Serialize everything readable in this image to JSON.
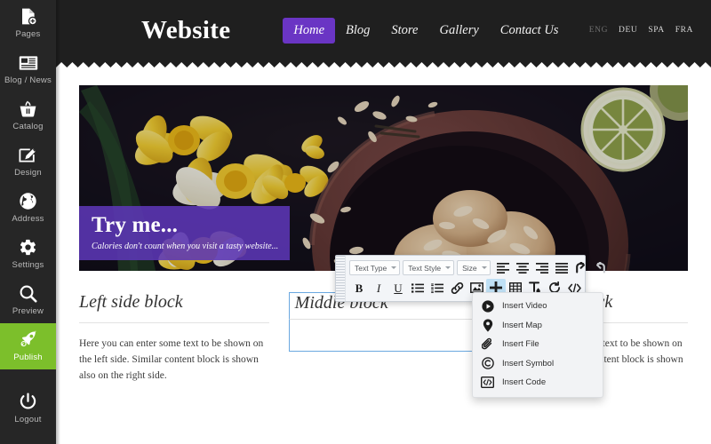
{
  "sidebar": {
    "items": [
      {
        "label": "Pages",
        "icon": "page-plus-icon",
        "active": false
      },
      {
        "label": "Blog / News",
        "icon": "news-icon",
        "active": false
      },
      {
        "label": "Catalog",
        "icon": "basket-icon",
        "active": false
      },
      {
        "label": "Design",
        "icon": "pencil-edit-icon",
        "active": false
      },
      {
        "label": "Address",
        "icon": "globe-icon",
        "active": false
      },
      {
        "label": "Settings",
        "icon": "gear-icon",
        "active": false
      },
      {
        "label": "Preview",
        "icon": "search-icon",
        "active": false
      },
      {
        "label": "Publish",
        "icon": "rocket-icon",
        "active": true
      }
    ],
    "logout": {
      "label": "Logout",
      "icon": "power-icon"
    },
    "active_color": "#7cbf2b",
    "background_color": "#262626"
  },
  "site": {
    "logo": "Website",
    "nav": [
      {
        "label": "Home",
        "current": true
      },
      {
        "label": "Blog",
        "current": false
      },
      {
        "label": "Store",
        "current": false
      },
      {
        "label": "Gallery",
        "current": false
      },
      {
        "label": "Contact Us",
        "current": false
      }
    ],
    "nav_active_color": "#6a35c4",
    "languages": [
      {
        "label": "ENG",
        "current": true
      },
      {
        "label": "DEU",
        "current": false
      },
      {
        "label": "SPA",
        "current": false
      },
      {
        "label": "FRA",
        "current": false
      }
    ],
    "hero": {
      "image_alt": "daffodils-and-almond-cookies-photo",
      "caption_title": "Try me...",
      "caption_subtitle": "Calories don't count when you visit a tasty website...",
      "caption_color": "#5c37b6"
    },
    "columns": [
      {
        "title": "Left side block",
        "body": "Here you can enter some text to be shown on the left side. Similar content block is shown also on the right side.",
        "editing": false
      },
      {
        "title": "Middle block",
        "body": "",
        "editing": true
      },
      {
        "title": "Right side block",
        "body": "Here you can enter some text to be shown on the right side. Similar content block is shown also on the left side.",
        "editing": false
      }
    ]
  },
  "toolbar": {
    "selects": [
      {
        "label": "Text Type"
      },
      {
        "label": "Text Style"
      },
      {
        "label": "Size"
      }
    ],
    "row1_buttons": [
      {
        "name": "align-left-button",
        "title": "Align Left"
      },
      {
        "name": "align-center-button",
        "title": "Align Center"
      },
      {
        "name": "align-right-button",
        "title": "Align Right"
      },
      {
        "name": "align-justify-button",
        "title": "Justify"
      },
      {
        "name": "undo-button",
        "title": "Undo"
      },
      {
        "name": "redo-button",
        "title": "Redo"
      }
    ],
    "row2_buttons": [
      {
        "name": "bold-button",
        "title": "Bold",
        "glyph": "B"
      },
      {
        "name": "italic-button",
        "title": "Italic",
        "glyph": "I"
      },
      {
        "name": "underline-button",
        "title": "Underline",
        "glyph": "U"
      },
      {
        "name": "bullet-list-button",
        "title": "Bulleted List",
        "glyph": ""
      },
      {
        "name": "numbered-list-button",
        "title": "Numbered List",
        "glyph": ""
      },
      {
        "name": "link-button",
        "title": "Insert Link",
        "glyph": ""
      },
      {
        "name": "image-button",
        "title": "Insert Image",
        "glyph": ""
      },
      {
        "name": "insert-plus-button",
        "title": "Insert",
        "glyph": "",
        "selected": true
      },
      {
        "name": "table-button",
        "title": "Insert Table",
        "glyph": ""
      },
      {
        "name": "text-color-button",
        "title": "Text Color",
        "glyph": ""
      },
      {
        "name": "clear-format-button",
        "title": "Clear Formatting",
        "glyph": ""
      },
      {
        "name": "source-code-button",
        "title": "Source Code",
        "glyph": ""
      }
    ]
  },
  "dropdown": {
    "items": [
      {
        "label": "Insert Video",
        "icon": "play-circle-icon"
      },
      {
        "label": "Insert Map",
        "icon": "map-pin-icon"
      },
      {
        "label": "Insert File",
        "icon": "paperclip-icon"
      },
      {
        "label": "Insert Symbol",
        "icon": "copyright-icon"
      },
      {
        "label": "Insert Code",
        "icon": "code-brackets-icon"
      }
    ]
  }
}
